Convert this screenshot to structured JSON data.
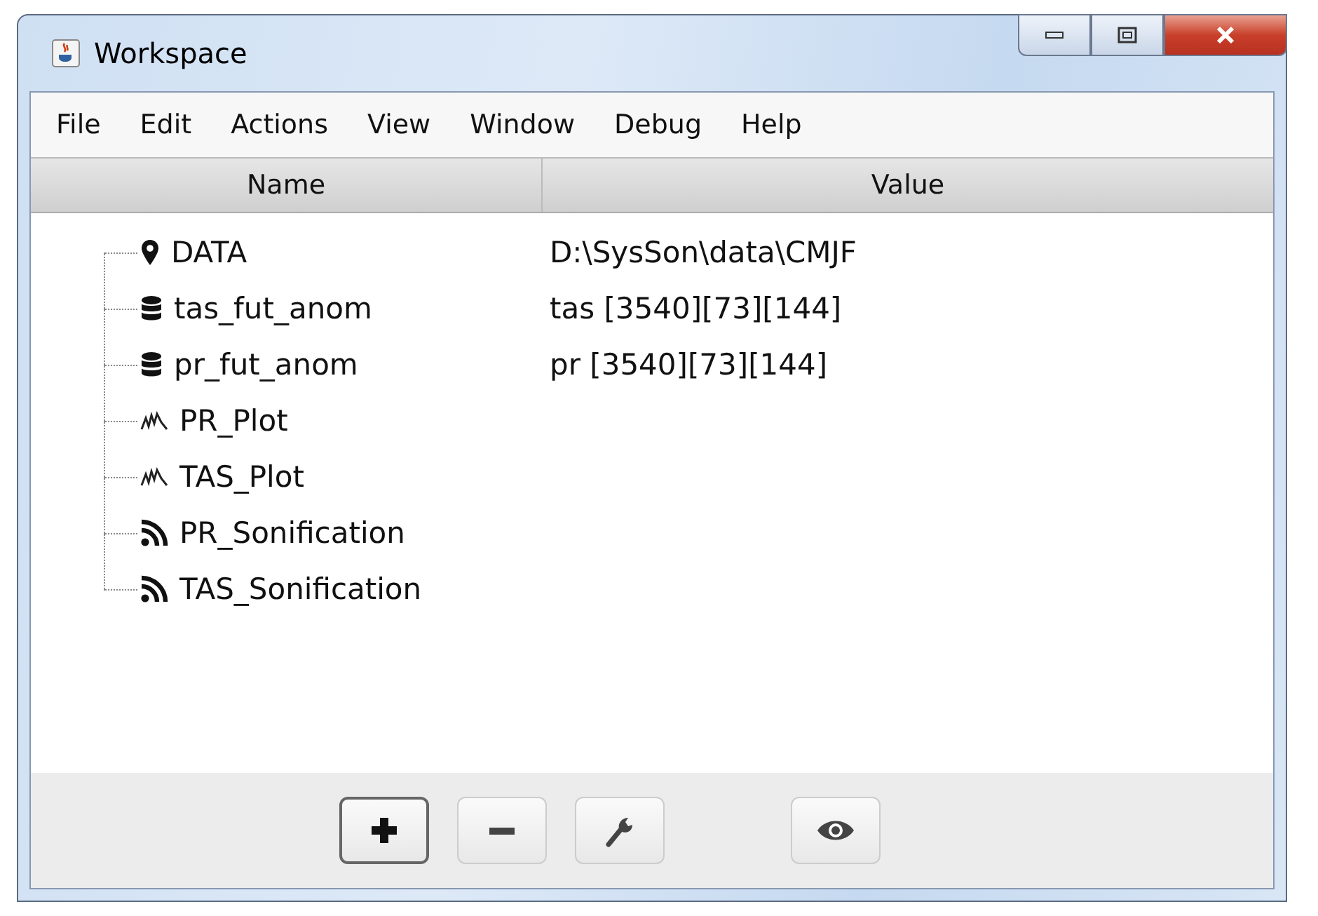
{
  "window": {
    "title": "Workspace"
  },
  "menu": [
    "File",
    "Edit",
    "Actions",
    "View",
    "Window",
    "Debug",
    "Help"
  ],
  "columns": [
    "Name",
    "Value"
  ],
  "rows": [
    {
      "kind": "location",
      "name": "DATA",
      "value": "D:\\SysSon\\data\\CMJF"
    },
    {
      "kind": "data",
      "name": "tas_fut_anom",
      "value": "tas [3540][73][144]"
    },
    {
      "kind": "data",
      "name": "pr_fut_anom",
      "value": "pr [3540][73][144]"
    },
    {
      "kind": "plot",
      "name": "PR_Plot"
    },
    {
      "kind": "plot",
      "name": "TAS_Plot"
    },
    {
      "kind": "sonification",
      "name": "PR_Sonification"
    },
    {
      "kind": "sonification",
      "name": "TAS_Sonification"
    }
  ],
  "toolbar": [
    {
      "kind": "add",
      "focused": true
    },
    {
      "kind": "remove",
      "focused": false
    },
    {
      "kind": "edit",
      "focused": false
    },
    {
      "kind": "view",
      "focused": false
    }
  ]
}
